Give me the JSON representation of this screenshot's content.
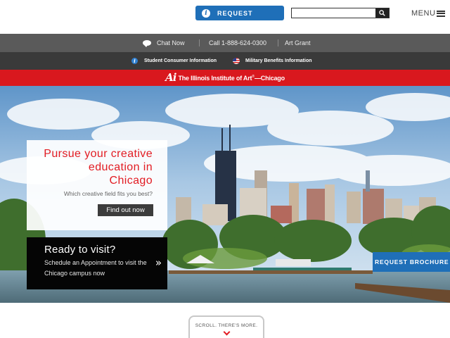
{
  "header": {
    "request_label": "REQUEST",
    "search_placeholder": "",
    "menu_label": "MENU"
  },
  "utility_bar": {
    "chat_label": "Chat Now",
    "phone_label": "Call 1-888-624-0300",
    "grant_label": "Art Grant"
  },
  "info_bar": {
    "consumer_label": "Student Consumer Information",
    "military_label": "Military Benefits Information"
  },
  "brand": {
    "logo_mark": "Ai",
    "name": "The Illinois Institute of Art",
    "campus": "—Chicago"
  },
  "hero": {
    "pursue_title_line1": "Pursue your creative",
    "pursue_title_line2": "education in",
    "pursue_title_line3": "Chicago",
    "pursue_subtitle": "Which creative field fits you best?",
    "find_button": "Find out now",
    "visit_title": "Ready to visit?",
    "visit_subtitle": "Schedule an Appointment to visit the Chicago campus now",
    "visit_arrow": "»",
    "brochure_button": "REQUEST BROCHURE"
  },
  "scroll": {
    "label": "SCROLL. THERE'S MORE."
  },
  "colors": {
    "brand_red": "#d9181e",
    "accent_blue": "#1f6fb8",
    "utility_gray": "#5a5a5a",
    "info_dark": "#3a3a3a"
  },
  "icons": {
    "request": "info-icon",
    "search": "search-icon",
    "menu": "hamburger-icon",
    "chat": "chat-bubble-icon",
    "consumer": "info-icon",
    "military": "us-flag-icon",
    "scroll": "chevron-down-icon"
  }
}
